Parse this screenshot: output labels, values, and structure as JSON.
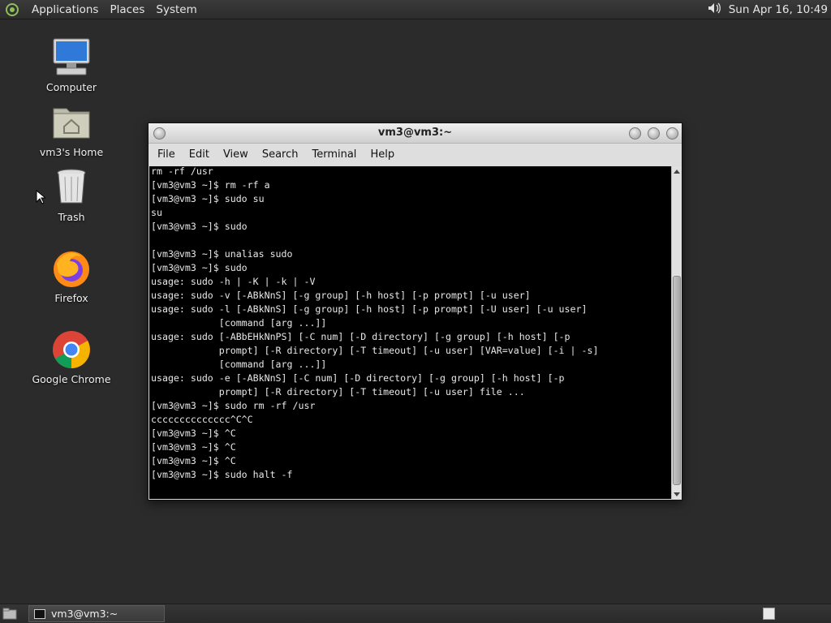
{
  "top_panel": {
    "menus": [
      "Applications",
      "Places",
      "System"
    ],
    "clock": "Sun Apr 16, 10:49"
  },
  "desktop": {
    "icons": [
      {
        "label": "Computer",
        "icon": "computer-icon"
      },
      {
        "label": "vm3's Home",
        "icon": "home-folder-icon"
      },
      {
        "label": "Trash",
        "icon": "trash-icon"
      },
      {
        "label": "Firefox",
        "icon": "firefox-icon"
      },
      {
        "label": "Google Chrome",
        "icon": "chrome-icon"
      }
    ]
  },
  "terminal": {
    "title": "vm3@vm3:~",
    "menu": [
      "File",
      "Edit",
      "View",
      "Search",
      "Terminal",
      "Help"
    ],
    "lines": [
      "rm -rf /usr",
      "[vm3@vm3 ~]$ rm -rf a",
      "[vm3@vm3 ~]$ sudo su",
      "su",
      "[vm3@vm3 ~]$ sudo",
      "",
      "[vm3@vm3 ~]$ unalias sudo",
      "[vm3@vm3 ~]$ sudo",
      "usage: sudo -h | -K | -k | -V",
      "usage: sudo -v [-ABkNnS] [-g group] [-h host] [-p prompt] [-u user]",
      "usage: sudo -l [-ABkNnS] [-g group] [-h host] [-p prompt] [-U user] [-u user]",
      "            [command [arg ...]]",
      "usage: sudo [-ABbEHkNnPS] [-C num] [-D directory] [-g group] [-h host] [-p",
      "            prompt] [-R directory] [-T timeout] [-u user] [VAR=value] [-i | -s]",
      "            [command [arg ...]]",
      "usage: sudo -e [-ABkNnS] [-C num] [-D directory] [-g group] [-h host] [-p",
      "            prompt] [-R directory] [-T timeout] [-u user] file ...",
      "[vm3@vm3 ~]$ sudo rm -rf /usr",
      "cccccccccccccc^C^C",
      "[vm3@vm3 ~]$ ^C",
      "[vm3@vm3 ~]$ ^C",
      "[vm3@vm3 ~]$ ^C",
      "[vm3@vm3 ~]$ sudo halt -f"
    ]
  },
  "taskbar": {
    "window_button": "vm3@vm3:~"
  }
}
